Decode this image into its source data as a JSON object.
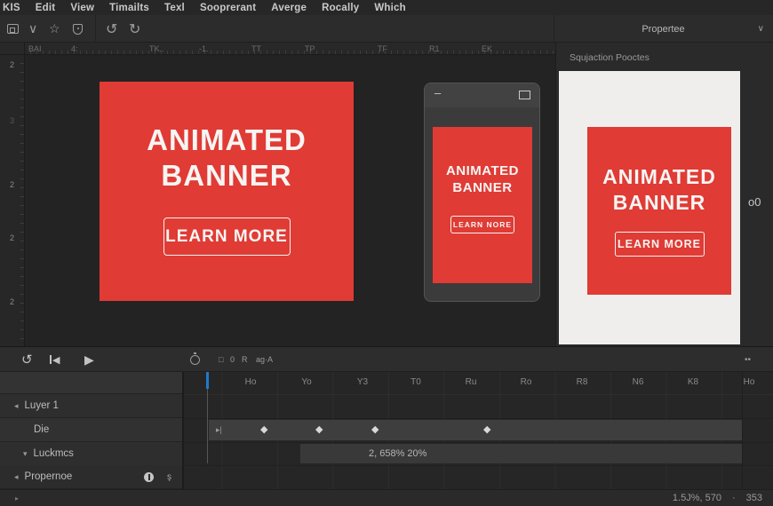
{
  "menu": {
    "items": [
      "KIS",
      "Edit",
      "View",
      "Timailts",
      "Texl",
      "Sooprerant",
      "Averge",
      "Rocally",
      "Which"
    ]
  },
  "toolbar": {
    "panel_tab": "Propertee"
  },
  "ruler_top": {
    "labels": [
      "BAI",
      "4:",
      "TK..",
      "-1.",
      "TT",
      "TP",
      "TF",
      "R1",
      "EK"
    ]
  },
  "ruler_left": {
    "labels": [
      "2",
      "3",
      "2",
      "2",
      "2"
    ]
  },
  "canvas": {
    "banner_large": {
      "title_line1": "ANIMATED",
      "title_line2": "BANNER",
      "button": "LEARN MORE"
    },
    "phone_banner": {
      "title_line1": "ANIMATED",
      "title_line2": "BANNER",
      "button": "LEARN NORE"
    }
  },
  "properties_panel": {
    "header": "Squjaction Pooctes",
    "side_label": "o0",
    "preview_banner": {
      "title_line1": "ANIMATED",
      "title_line2": "BANNER",
      "button": "LEARN MORE"
    }
  },
  "timeline": {
    "ruler_labels": [
      "Ho",
      "Yo",
      "Y3",
      "T0",
      "Ru",
      "Ro",
      "R8",
      "N6",
      "K8",
      "Ho"
    ],
    "toggles": [
      "□",
      "0",
      "R",
      "ag·A"
    ],
    "layers": [
      "Luyer 1",
      "Die",
      "Luckmcs",
      "Propernoe"
    ],
    "value_bar_text": "2, 658% 20%",
    "status": {
      "zoom_text": "1.5J%, 570",
      "sep": "·",
      "count": "353"
    }
  },
  "icons": {
    "chevron_down": "∨",
    "star": "☆",
    "shield": "shield",
    "frame": "frame",
    "undo": "↺",
    "refresh": "↻",
    "play": "▶",
    "prev": "◀",
    "minus": "–",
    "keyframe": "◆",
    "arrow_left": "◂",
    "arrow_down": "▾",
    "arrow_right": "▸",
    "dots": "••",
    "track_marker": "▸|",
    "s_glyph": "ş"
  },
  "colors": {
    "accent_red": "#e03b35",
    "playhead_blue": "#2079cc",
    "preview_bg": "#efeeec"
  }
}
